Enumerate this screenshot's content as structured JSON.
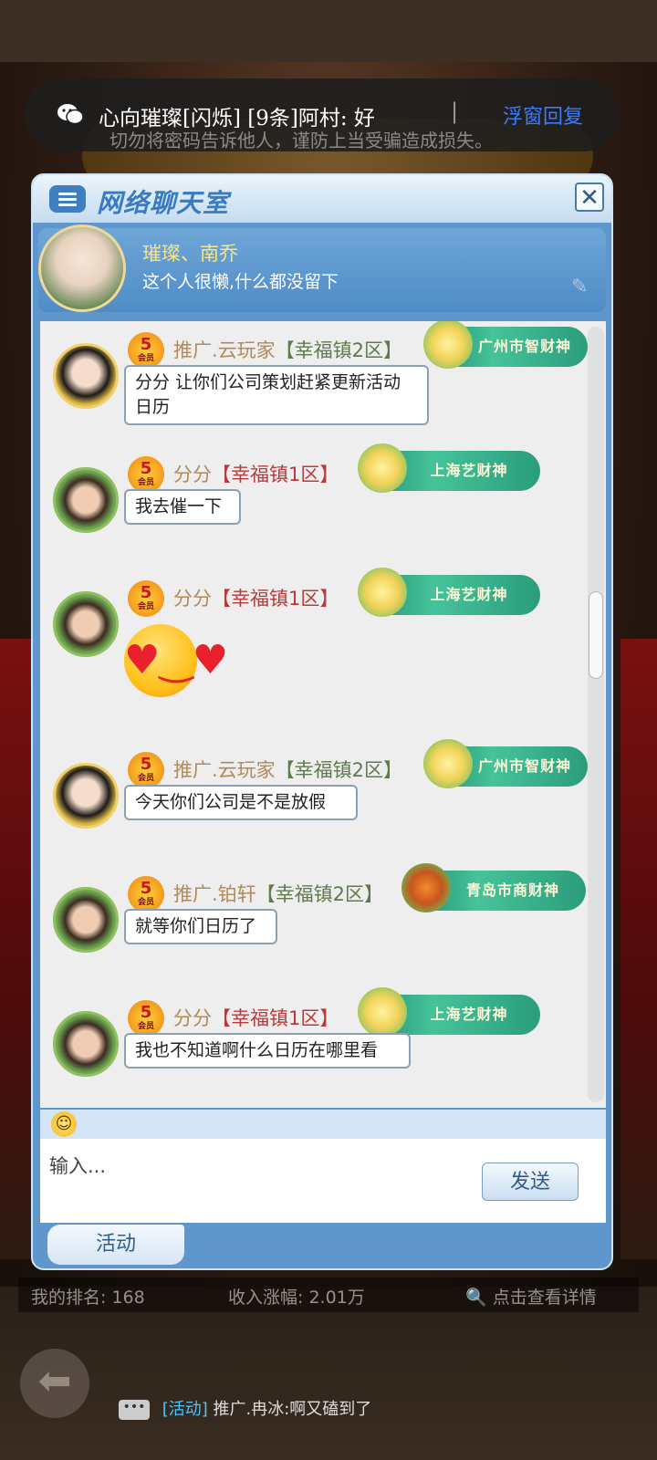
{
  "notification": {
    "message": "心向璀璨[闪烁]  [9条]阿村: 好",
    "separator": "|",
    "reply_label": "浮窗回复"
  },
  "warning": "切勿将密码告诉他人，谨防上当受骗造成损失。",
  "dialog": {
    "title": "网络聊天室",
    "close_label": "✕",
    "profile": {
      "name": "璀璨、南乔",
      "signature": "这个人很懒,什么都没留下"
    }
  },
  "messages": [
    {
      "vip": "5",
      "vip_sub": "会员",
      "name": "推广.云玩家",
      "zone": "【幸福镇2区】",
      "badge": "广州市智财神",
      "text": "分分 让你们公司策划赶紧更新活动日历"
    },
    {
      "vip": "5",
      "vip_sub": "会员",
      "name": "分分",
      "zone": "【幸福镇1区】",
      "badge": "上海艺财神",
      "text": "我去催一下"
    },
    {
      "vip": "5",
      "vip_sub": "会员",
      "name": "分分",
      "zone": "【幸福镇1区】",
      "badge": "上海艺财神",
      "emoji": "heart-eyes-emoji"
    },
    {
      "vip": "5",
      "vip_sub": "会员",
      "name": "推广.云玩家",
      "zone": "【幸福镇2区】",
      "badge": "广州市智财神",
      "text": "今天你们公司是不是放假"
    },
    {
      "vip": "5",
      "vip_sub": "会员",
      "name": "推广.铂轩",
      "zone": "【幸福镇2区】",
      "badge": "青岛市商财神",
      "text": "就等你们日历了"
    },
    {
      "vip": "5",
      "vip_sub": "会员",
      "name": "分分",
      "zone": "【幸福镇1区】",
      "badge": "上海艺财神",
      "text": "我也不知道啊什么日历在哪里看"
    }
  ],
  "input": {
    "placeholder": "输入...",
    "send_label": "发送"
  },
  "tab": {
    "activity_label": "活动"
  },
  "footer": {
    "rank": "我的排名: 168",
    "growth": "收入涨幅: 2.01万",
    "details": "点击查看详情"
  },
  "ticker": {
    "tag": "[活动]",
    "text": "推广.冉冰:啊又磕到了"
  },
  "colors": {
    "dialog_blue": "#5f97cc",
    "title_blue": "#3a7ac2",
    "zone_red": "#b83a3a",
    "name_gold": "#b08a58"
  }
}
